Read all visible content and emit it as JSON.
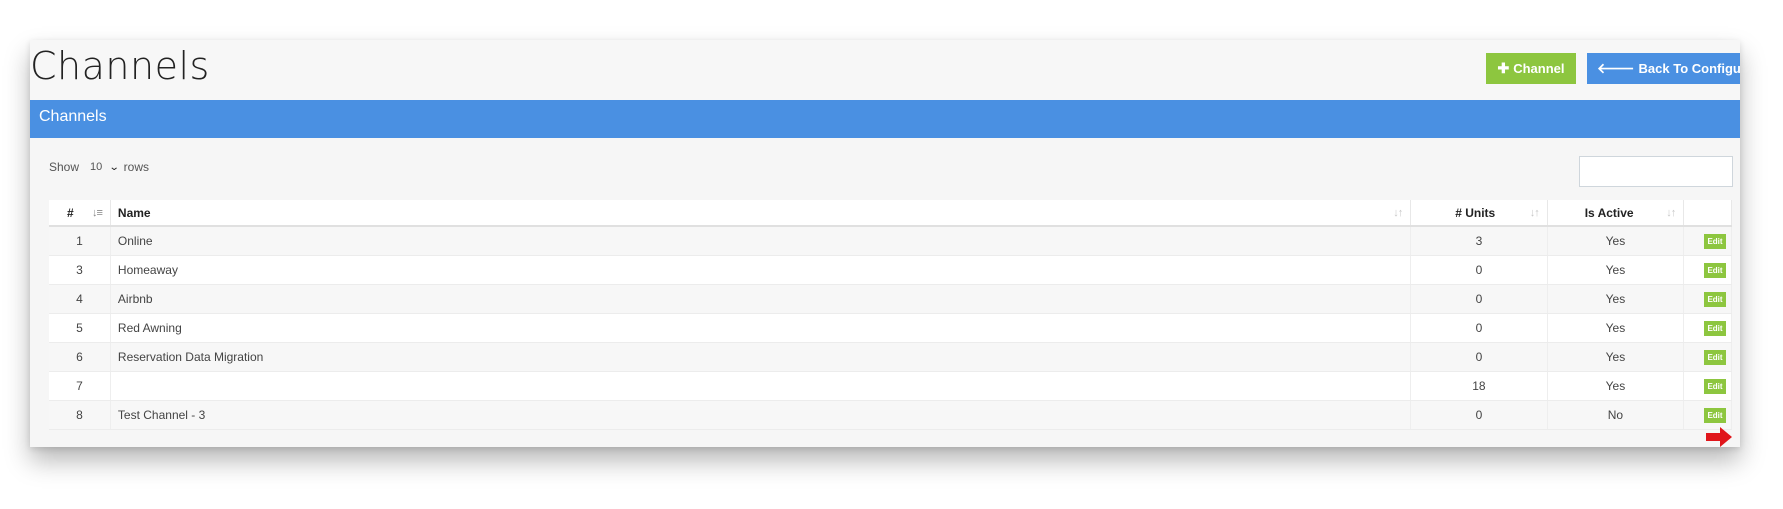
{
  "page": {
    "title": "Channels"
  },
  "toolbar": {
    "add_label": "Channel",
    "add_icon": "plus-icon",
    "back_label": "Back To Configuration",
    "back_icon": "arrow-left-icon"
  },
  "panel": {
    "title": "Channels"
  },
  "length": {
    "prefix": "Show",
    "value": "10",
    "suffix": "rows"
  },
  "search": {
    "value": ""
  },
  "table": {
    "headers": {
      "num": "#",
      "name": "Name",
      "units": "# Units",
      "active": "Is Active",
      "actions": ""
    },
    "rows": [
      {
        "num": "1",
        "name": "Online",
        "units": "3",
        "active": "Yes",
        "action": "Edit"
      },
      {
        "num": "3",
        "name": "Homeaway",
        "units": "0",
        "active": "Yes",
        "action": "Edit"
      },
      {
        "num": "4",
        "name": "Airbnb",
        "units": "0",
        "active": "Yes",
        "action": "Edit"
      },
      {
        "num": "5",
        "name": "Red Awning",
        "units": "0",
        "active": "Yes",
        "action": "Edit"
      },
      {
        "num": "6",
        "name": "Reservation Data Migration",
        "units": "0",
        "active": "Yes",
        "action": "Edit"
      },
      {
        "num": "7",
        "name": "",
        "units": "18",
        "active": "Yes",
        "action": "Edit"
      },
      {
        "num": "8",
        "name": "Test Channel - 3",
        "units": "0",
        "active": "No",
        "action": "Edit"
      }
    ]
  },
  "colors": {
    "accent_green": "#8dc63f",
    "accent_blue": "#4a90e2",
    "annotation_red": "#e0161b"
  }
}
